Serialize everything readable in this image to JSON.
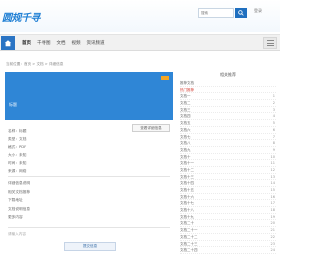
{
  "header": {
    "logo": "圆规千寻",
    "search_placeholder": "搜索",
    "link": "登录"
  },
  "nav": {
    "items": [
      {
        "label": "首页"
      },
      {
        "label": "千寻图"
      },
      {
        "label": "文档"
      },
      {
        "label": "视频"
      },
      {
        "label": "资讯频道"
      }
    ]
  },
  "breadcrumb": "当前位置：首页 > 文档 > 详细信息",
  "main": {
    "banner_text": "标题",
    "info_button": "查看详细信息",
    "fields": [
      "名称：标题",
      "类型：文档",
      "格式：PDF",
      "大小：未知",
      "时间：未知",
      "来源：网络",
      "作者：未知"
    ],
    "section_b": [
      "详细信息说明",
      "相关文档推荐",
      "下载地址",
      "文档说明信息",
      "更多内容"
    ],
    "footer_input": "请输入内容",
    "submit_label": "提交信息"
  },
  "sidebar": {
    "title": "相关推荐",
    "rows": [
      {
        "label": "推荐文档",
        "value": ""
      },
      {
        "label": "热门推荐",
        "value": "",
        "highlight": true
      },
      {
        "label": "文档一",
        "value": "1"
      },
      {
        "label": "文档二",
        "value": "2"
      },
      {
        "label": "文档三",
        "value": "3"
      },
      {
        "label": "文档四",
        "value": "4"
      },
      {
        "label": "文档五",
        "value": "5"
      },
      {
        "label": "文档六",
        "value": "6"
      },
      {
        "label": "文档七",
        "value": "7"
      },
      {
        "label": "文档八",
        "value": "8"
      },
      {
        "label": "文档九",
        "value": "9"
      },
      {
        "label": "文档十",
        "value": "10"
      },
      {
        "label": "文档十一",
        "value": "11"
      },
      {
        "label": "文档十二",
        "value": "12"
      },
      {
        "label": "文档十三",
        "value": "13"
      },
      {
        "label": "文档十四",
        "value": "14"
      },
      {
        "label": "文档十五",
        "value": "15"
      },
      {
        "label": "文档十六",
        "value": "16"
      },
      {
        "label": "文档十七",
        "value": "17"
      },
      {
        "label": "文档十八",
        "value": "18"
      },
      {
        "label": "文档十九",
        "value": "19"
      },
      {
        "label": "文档二十",
        "value": "20"
      },
      {
        "label": "文档二十一",
        "value": "21"
      },
      {
        "label": "文档二十二",
        "value": "22"
      },
      {
        "label": "文档二十三",
        "value": "23"
      },
      {
        "label": "文档二十四",
        "value": "24"
      }
    ]
  },
  "colors": {
    "brand": "#1f7fd4",
    "nav_home": "#2a74c4",
    "banner": "#2f86d6",
    "banner_tag": "#f5a623",
    "highlight": "#d23a2f"
  },
  "icons": {
    "search": "search-icon",
    "home": "home-icon",
    "menu": "menu-icon"
  }
}
